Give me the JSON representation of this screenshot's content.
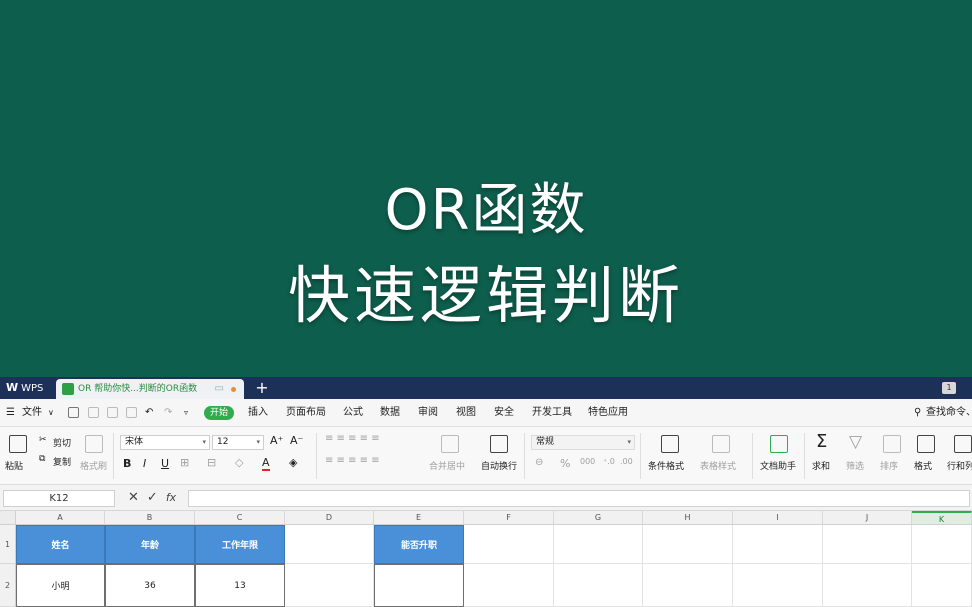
{
  "banner": {
    "line1": "OR函数",
    "line2": "快速逻辑判断"
  },
  "tabs": {
    "wps": "WPS",
    "doc": "OR 帮助你快...判断的OR函数",
    "add": "+",
    "page_num": "1"
  },
  "menu": {
    "file": "文件",
    "start": "开始",
    "items": [
      "插入",
      "页面布局",
      "公式",
      "数据",
      "审阅",
      "视图",
      "安全",
      "开发工具",
      "特色应用"
    ],
    "search": "查找命令、"
  },
  "ribbon": {
    "paste": "粘贴",
    "cut": "剪切",
    "copy": "复制",
    "format_painter": "格式刷",
    "font": "宋体",
    "size": "12",
    "grow": "A⁺",
    "shrink": "A⁻",
    "bold": "B",
    "italic": "I",
    "underline": "U",
    "font_color": "A",
    "merge": "合并居中",
    "wrap": "自动换行",
    "number_format": "常规",
    "percent": "%",
    "cond_format": "条件格式",
    "table_style": "表格样式",
    "doc_helper": "文档助手",
    "sum": "求和",
    "filter": "筛选",
    "sort": "排序",
    "format": "格式",
    "rowcol": "行和列"
  },
  "formula": {
    "cell_ref": "K12",
    "fx": "fx",
    "value": ""
  },
  "sheet": {
    "columns": [
      "A",
      "B",
      "C",
      "D",
      "E",
      "F",
      "G",
      "H",
      "I",
      "J",
      "K"
    ],
    "selected_column": "K",
    "rows": [
      "1",
      "2"
    ],
    "row1": {
      "A": "姓名",
      "B": "年龄",
      "C": "工作年限",
      "D": "",
      "E": "能否升职"
    },
    "row2": {
      "A": "小明",
      "B": "36",
      "C": "13",
      "D": "",
      "E": ""
    }
  },
  "colors": {
    "banner_bg": "#0e5e4d",
    "header_fill": "#4a90d9",
    "accent": "#2eac4e"
  }
}
